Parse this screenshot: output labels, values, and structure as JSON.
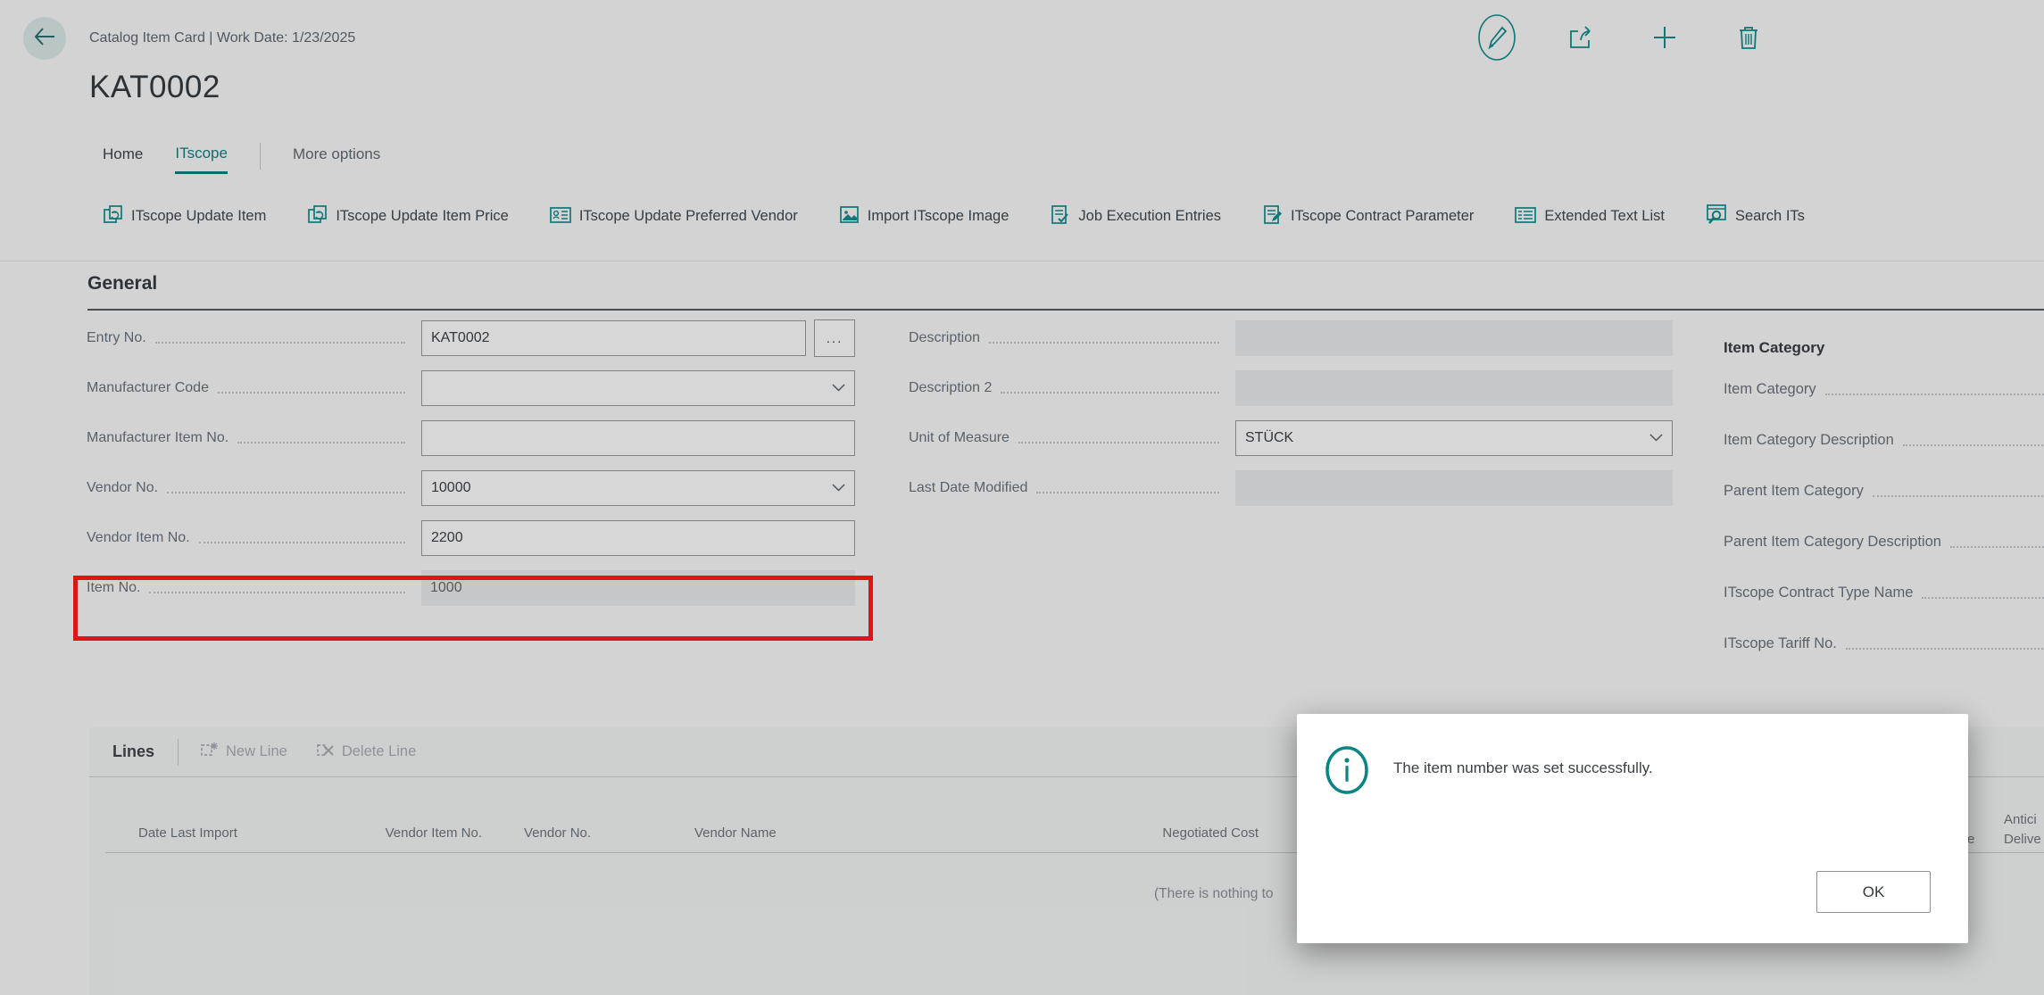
{
  "colors": {
    "accent_teal": "#0e7c7c",
    "icon_teal": "#0a8a8a",
    "annotation_red": "#df1414",
    "info_teal": "#0b8484"
  },
  "header": {
    "breadcrumb": "Catalog Item Card | Work Date: 1/23/2025",
    "title": "KAT0002",
    "actions": [
      {
        "name": "edit"
      },
      {
        "name": "share"
      },
      {
        "name": "new"
      },
      {
        "name": "delete"
      }
    ]
  },
  "tabs": {
    "home": "Home",
    "itscope": "ITscope",
    "more": "More options",
    "active": "ITscope"
  },
  "action_bar": {
    "items": [
      {
        "label": "ITscope Update Item"
      },
      {
        "label": "ITscope Update Item Price"
      },
      {
        "label": "ITscope Update Preferred Vendor"
      },
      {
        "label": "Import ITscope Image"
      },
      {
        "label": "Job Execution Entries"
      },
      {
        "label": "ITscope Contract Parameter"
      },
      {
        "label": "Extended Text List"
      },
      {
        "label": "Search ITs"
      }
    ]
  },
  "general": {
    "section_title": "General",
    "fields_left": [
      {
        "label": "Entry No.",
        "value": "KAT0002",
        "type": "text-assist",
        "assist": "..."
      },
      {
        "label": "Manufacturer Code",
        "value": "",
        "type": "dropdown"
      },
      {
        "label": "Manufacturer Item No.",
        "value": "",
        "type": "text"
      },
      {
        "label": "Vendor No.",
        "value": "10000",
        "type": "dropdown"
      },
      {
        "label": "Vendor Item No.",
        "value": "2200",
        "type": "text"
      },
      {
        "label": "Item No.",
        "value": "1000",
        "type": "disabled",
        "annotated": true
      }
    ],
    "fields_middle": [
      {
        "label": "Description",
        "value": "",
        "type": "disabled"
      },
      {
        "label": "Description 2",
        "value": "",
        "type": "disabled"
      },
      {
        "label": "Unit of Measure",
        "value": "STÜCK",
        "type": "dropdown"
      },
      {
        "label": "Last Date Modified",
        "value": "",
        "type": "disabled"
      }
    ],
    "item_category": {
      "title": "Item Category",
      "fields": [
        {
          "label": "Item Category"
        },
        {
          "label": "Item Category Description"
        },
        {
          "label": "Parent Item Category"
        },
        {
          "label": "Parent Item Category Description"
        },
        {
          "label": "ITscope Contract Type Name"
        },
        {
          "label": "ITscope Tariff No."
        }
      ]
    }
  },
  "lines": {
    "title": "Lines",
    "toolbar": {
      "new_line": "New Line",
      "delete_line": "Delete Line"
    },
    "columns": {
      "c0": "Date Last Import",
      "c1": "Vendor Item No.",
      "c2": "Vendor No.",
      "c3": "Vendor Name",
      "c4": "Negotiated Cost",
      "clipped_fragment": "e",
      "clipped_line1": "Antici",
      "clipped_line2": "Delive"
    },
    "empty_text": "(There is nothing to"
  },
  "dialog": {
    "message": "The item number was set successfully.",
    "ok_label": "OK"
  }
}
